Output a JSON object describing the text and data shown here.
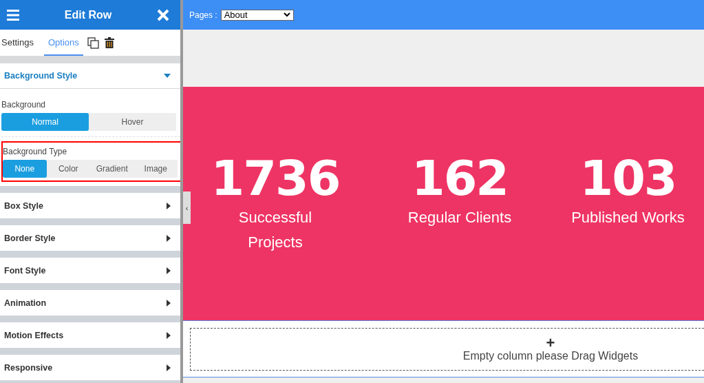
{
  "panel": {
    "title": "Edit Row",
    "tabs": [
      {
        "label": "Settings",
        "selected": false
      },
      {
        "label": "Options",
        "selected": true
      }
    ],
    "sections": [
      {
        "label": "Background Style",
        "expanded": true,
        "groups": [
          {
            "label": "Background",
            "highlighted": false,
            "options": [
              {
                "label": "Normal",
                "selected": true
              },
              {
                "label": "Hover",
                "selected": false
              }
            ]
          },
          {
            "label": "Background Type",
            "highlighted": true,
            "options": [
              {
                "label": "None",
                "selected": true
              },
              {
                "label": "Color",
                "selected": false
              },
              {
                "label": "Gradient",
                "selected": false
              },
              {
                "label": "Image",
                "selected": false
              }
            ]
          }
        ]
      },
      {
        "label": "Box Style",
        "expanded": false
      },
      {
        "label": "Border Style",
        "expanded": false
      },
      {
        "label": "Font Style",
        "expanded": false
      },
      {
        "label": "Animation",
        "expanded": false
      },
      {
        "label": "Motion Effects",
        "expanded": false
      },
      {
        "label": "Responsive",
        "expanded": false
      }
    ]
  },
  "collapse_handle": "‹",
  "topbar": {
    "label": "Pages :",
    "page": "About"
  },
  "stats": [
    {
      "number": "1736",
      "label": "Successful Projects"
    },
    {
      "number": "162",
      "label": "Regular Clients"
    },
    {
      "number": "103",
      "label": "Published Works"
    }
  ],
  "empty_column": {
    "icon": "+",
    "text": "Empty column please Drag Widgets"
  }
}
